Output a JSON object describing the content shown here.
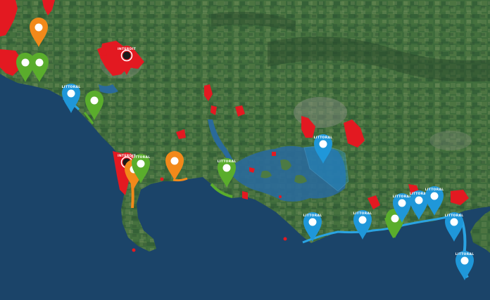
{
  "map": {
    "colors": {
      "sea": "#1b4469",
      "land": "#3e6b3d",
      "flood_red": "#e31921",
      "littoral_blue": "#1f97d9",
      "orange": "#f2891a",
      "green": "#5aad2c",
      "intertidal": "#2d6f9e"
    },
    "markers": [
      {
        "id": "m1",
        "color": "orange",
        "label": "",
        "icon": "map-pin-icon"
      },
      {
        "id": "m2",
        "color": "green",
        "label": "",
        "icon": "map-pin-icon"
      },
      {
        "id": "m3",
        "color": "green",
        "label": "",
        "icon": "map-pin-icon"
      },
      {
        "id": "m4",
        "color": "red",
        "label": "INTERDIT",
        "icon": "map-pin-icon"
      },
      {
        "id": "m5",
        "color": "blue",
        "label": "LITTORAL",
        "icon": "map-pin-icon"
      },
      {
        "id": "m6",
        "color": "green",
        "label": "",
        "icon": "map-pin-icon"
      },
      {
        "id": "m7",
        "color": "red",
        "label": "INTERDIT",
        "icon": "map-pin-icon"
      },
      {
        "id": "m8",
        "color": "orange",
        "label": "",
        "icon": "map-pin-icon"
      },
      {
        "id": "m9",
        "color": "green",
        "label": "LITTORAL",
        "icon": "map-pin-icon"
      },
      {
        "id": "m10",
        "color": "orange",
        "label": "",
        "icon": "map-pin-icon"
      },
      {
        "id": "m11",
        "color": "green",
        "label": "LITTORAL",
        "icon": "map-pin-icon"
      },
      {
        "id": "m12",
        "color": "blue",
        "label": "LITTORAL",
        "icon": "map-pin-icon"
      },
      {
        "id": "m13",
        "color": "blue",
        "label": "LITTORAL",
        "icon": "map-pin-icon"
      },
      {
        "id": "m14",
        "color": "blue",
        "label": "LITTORAL",
        "icon": "map-pin-icon"
      },
      {
        "id": "m15",
        "color": "green",
        "label": "",
        "icon": "map-pin-icon"
      },
      {
        "id": "m16",
        "color": "blue",
        "label": "LITTORAL",
        "icon": "map-pin-icon"
      },
      {
        "id": "m17",
        "color": "blue",
        "label": "LITTORAL",
        "icon": "map-pin-icon"
      },
      {
        "id": "m18",
        "color": "blue",
        "label": "LITTORAL",
        "icon": "map-pin-icon"
      },
      {
        "id": "m19",
        "color": "blue",
        "label": "LITTORAL",
        "icon": "map-pin-icon"
      },
      {
        "id": "m20",
        "color": "blue",
        "label": "LITTORAL",
        "icon": "map-pin-icon"
      }
    ]
  }
}
